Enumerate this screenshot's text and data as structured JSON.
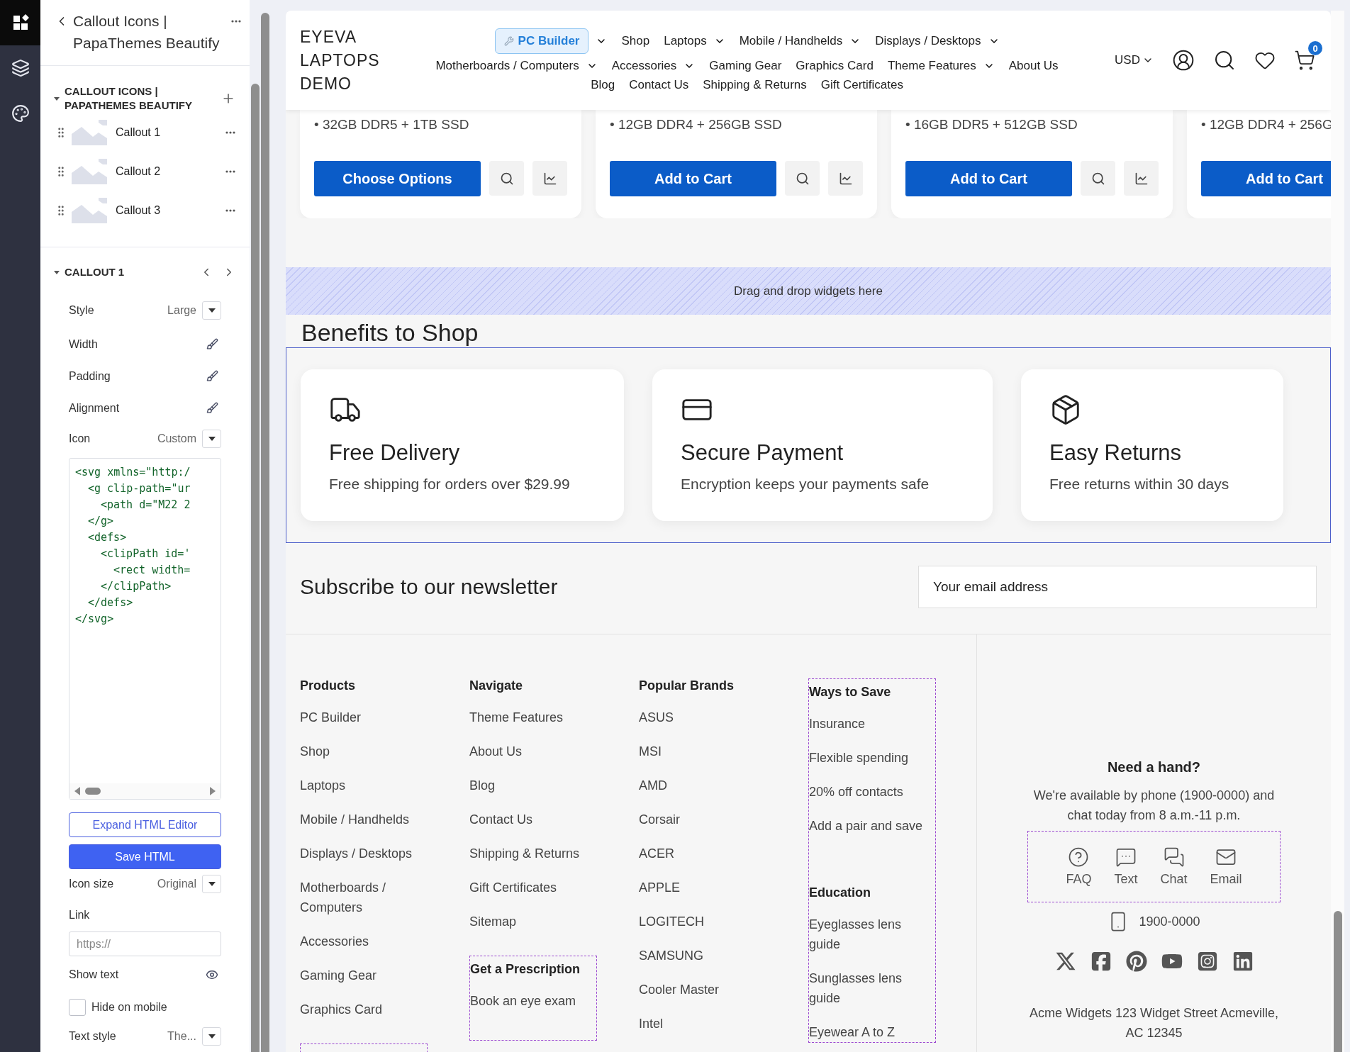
{
  "rail": [
    {
      "kind": "widgets",
      "selected": true
    },
    {
      "kind": "layers",
      "selected": false
    },
    {
      "kind": "palette",
      "selected": false
    }
  ],
  "panel": {
    "title": "Callout Icons | PapaThemes Beautify",
    "section": {
      "title": "CALLOUT ICONS | PAPATHEMES BEAUTIFY",
      "expanded": true,
      "items": [
        {
          "label": "Callout 1"
        },
        {
          "label": "Callout 2"
        },
        {
          "label": "Callout 3"
        }
      ]
    },
    "editor": {
      "title": "CALLOUT 1",
      "expanded": true,
      "fields": [
        {
          "kind": "select",
          "label": "Style",
          "value": "Large"
        },
        {
          "kind": "brush",
          "label": "Width"
        },
        {
          "kind": "brush",
          "label": "Padding"
        },
        {
          "kind": "brush",
          "label": "Alignment"
        },
        {
          "kind": "select",
          "label": "Icon",
          "value": "Custom"
        },
        {
          "kind": "code",
          "code": {
            "open": "<svg xmlns=\"http:/",
            "close": "</svg>",
            "children": [
              {
                "open": "<g clip-path=\"ur",
                "close": "</g>",
                "children": [
                  {
                    "open": "<path d=\"M22 2"
                  }
                ]
              },
              {
                "open": "<defs>",
                "close": "</defs>",
                "children": [
                  {
                    "open": "<clipPath id='",
                    "close": "</clipPath>",
                    "children": [
                      {
                        "open": "<rect width="
                      }
                    ]
                  }
                ]
              }
            ]
          }
        },
        {
          "kind": "outline_button",
          "label": "Expand HTML Editor"
        },
        {
          "kind": "primary_button",
          "label": "Save HTML"
        },
        {
          "kind": "select",
          "label": "Icon size",
          "value": "Original"
        },
        {
          "kind": "input",
          "label": "Link",
          "placeholder": "https://"
        },
        {
          "kind": "toggle",
          "label": "Show text",
          "visible": true
        },
        {
          "kind": "checkbox",
          "label": "Hide on mobile",
          "checked": false
        },
        {
          "kind": "select",
          "label": "Text style",
          "value": "The..."
        }
      ]
    }
  },
  "header": {
    "logo": "EYEVA LAPTOPS DEMO",
    "nav_rows": [
      [
        {
          "label": "PC Builder",
          "kind": "badge",
          "dropdown": true
        },
        {
          "label": "Shop",
          "kind": "link",
          "dropdown": false
        },
        {
          "label": "Laptops",
          "kind": "link",
          "dropdown": true
        },
        {
          "label": "Mobile / Handhelds",
          "kind": "link",
          "dropdown": true
        },
        {
          "label": "Displays / Desktops",
          "kind": "link",
          "dropdown": true
        }
      ],
      [
        {
          "label": "Motherboards / Computers",
          "kind": "link",
          "dropdown": true
        },
        {
          "label": "Accessories",
          "kind": "link",
          "dropdown": true
        },
        {
          "label": "Gaming Gear",
          "kind": "link",
          "dropdown": false
        },
        {
          "label": "Graphics Card",
          "kind": "link",
          "dropdown": false
        },
        {
          "label": "Theme Features",
          "kind": "link",
          "dropdown": true
        },
        {
          "label": "About Us",
          "kind": "link",
          "dropdown": false
        }
      ],
      [
        {
          "label": "Blog",
          "kind": "link",
          "dropdown": false
        },
        {
          "label": "Contact Us",
          "kind": "link",
          "dropdown": false
        },
        {
          "label": "Shipping & Returns",
          "kind": "link",
          "dropdown": false
        },
        {
          "label": "Gift Certificates",
          "kind": "link",
          "dropdown": false
        }
      ]
    ],
    "currency": "USD",
    "cart_count": "0"
  },
  "products": [
    {
      "spec": "• 32GB DDR5 + 1TB SSD",
      "action": "Choose Options",
      "tools": true
    },
    {
      "spec": "• 12GB DDR4 + 256GB SSD",
      "action": "Add to Cart",
      "tools": true
    },
    {
      "spec": "• 16GB DDR5 + 512GB SSD",
      "action": "Add to Cart",
      "tools": true
    },
    {
      "spec": "• 12GB DDR4 + 256G",
      "action": "Add to Cart",
      "tools": false
    }
  ],
  "drop_zone": "Drag and drop widgets here",
  "benefits": {
    "title": "Benefits to Shop",
    "items": [
      {
        "kind": "delivery",
        "title": "Free Delivery",
        "text": "Free shipping for orders over $29.99"
      },
      {
        "kind": "payment",
        "title": "Secure Payment",
        "text": "Encryption keeps your payments safe"
      },
      {
        "kind": "returns",
        "title": "Easy Returns",
        "text": "Free returns within 30 days"
      }
    ]
  },
  "newsletter": {
    "title": "Subscribe to our newsletter",
    "placeholder": "Your email address"
  },
  "footer": {
    "columns": [
      {
        "blocks": [
          {
            "outlined": false,
            "groups": [
              {
                "heading": "Products",
                "links": [
                  "PC Builder",
                  "Shop",
                  "Laptops",
                  "Mobile / Handhelds",
                  "Displays / Desktops",
                  "Motherboards / Computers",
                  "Accessories",
                  "Gaming Gear",
                  "Graphics Card"
                ]
              }
            ]
          },
          {
            "outlined": true
          }
        ]
      },
      {
        "blocks": [
          {
            "outlined": false,
            "groups": [
              {
                "heading": "Navigate",
                "links": [
                  "Theme Features",
                  "About Us",
                  "Blog",
                  "Contact Us",
                  "Shipping & Returns",
                  "Gift Certificates",
                  "Sitemap"
                ]
              }
            ]
          },
          {
            "outlined": true,
            "groups": [
              {
                "heading": "Get a Prescription",
                "links": [
                  "Book an eye exam"
                ]
              }
            ]
          }
        ]
      },
      {
        "blocks": [
          {
            "outlined": false,
            "groups": [
              {
                "heading": "Popular Brands",
                "links": [
                  "ASUS",
                  "MSI",
                  "AMD",
                  "Corsair",
                  "ACER",
                  "APPLE",
                  "LOGITECH",
                  "SAMSUNG",
                  "Cooler Master",
                  "Intel"
                ]
              }
            ]
          }
        ]
      },
      {
        "blocks": [
          {
            "outlined": true,
            "groups": [
              {
                "heading": "Ways to Save",
                "links": [
                  "Insurance",
                  "Flexible spending",
                  "20% off contacts",
                  "Add a pair and save"
                ]
              },
              {
                "heading": "Education",
                "links": [
                  "Eyeglasses lens guide",
                  "Sunglasses lens guide",
                  "Eyewear A to Z"
                ]
              }
            ]
          }
        ]
      }
    ],
    "help": {
      "title": "Need a hand?",
      "text": "We're available by phone (1900-0000) and chat today from 8 a.m.-11 p.m.",
      "contacts": [
        {
          "kind": "faq",
          "label": "FAQ"
        },
        {
          "kind": "text",
          "label": "Text"
        },
        {
          "kind": "chat",
          "label": "Chat"
        },
        {
          "kind": "email",
          "label": "Email"
        }
      ],
      "phone": "1900-0000",
      "social": [
        {
          "kind": "x"
        },
        {
          "kind": "facebook"
        },
        {
          "kind": "pinterest"
        },
        {
          "kind": "youtube"
        },
        {
          "kind": "instagram"
        },
        {
          "kind": "linkedin"
        }
      ],
      "address": "Acme Widgets 123 Widget Street Acmeville, AC 12345"
    }
  }
}
